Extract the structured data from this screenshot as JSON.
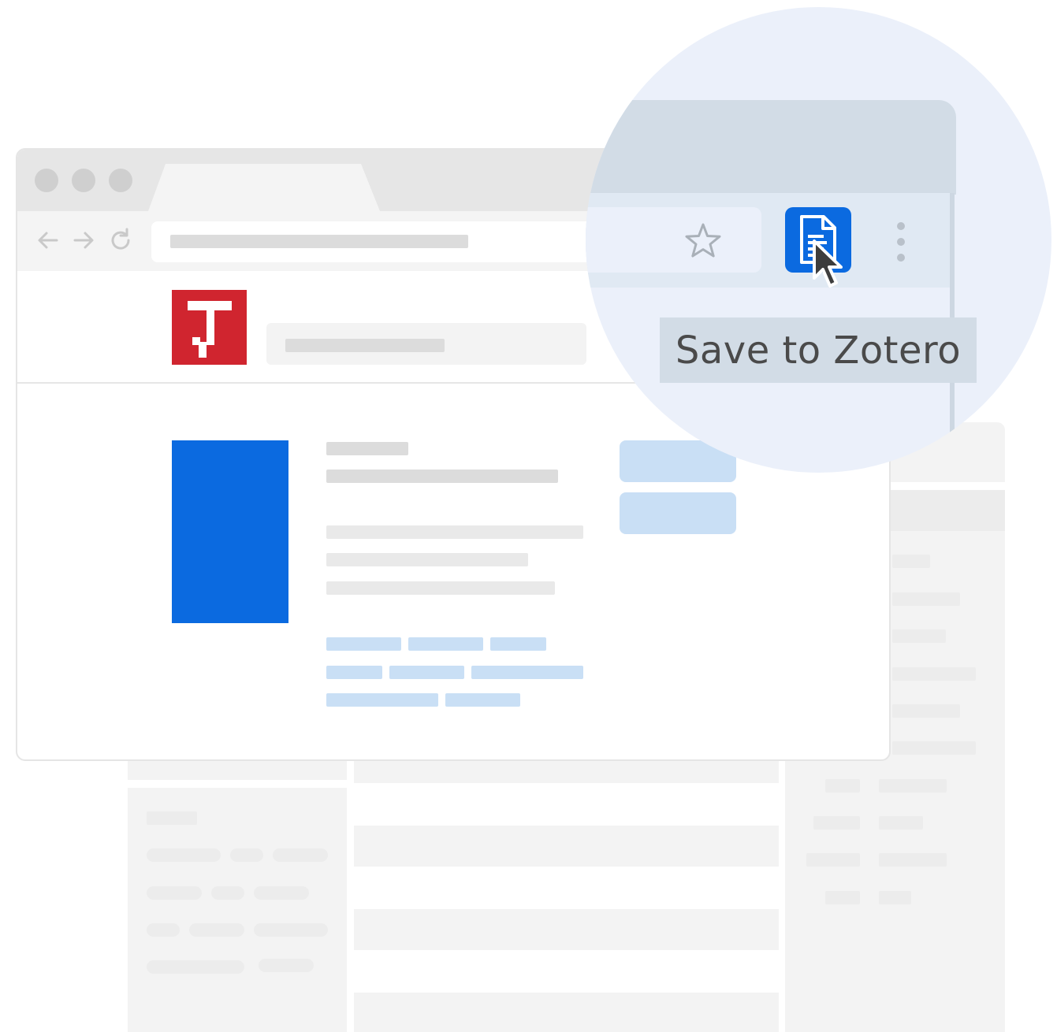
{
  "browser": {
    "window_buttons": [
      "close",
      "minimize",
      "maximize"
    ],
    "nav_icons": [
      "back-arrow-icon",
      "forward-arrow-icon",
      "reload-icon"
    ],
    "site_logo_letter": "J"
  },
  "extension": {
    "icon": "zotero-document-icon",
    "tooltip": "Save to Zotero",
    "bookmark_icon": "star-icon",
    "menu_icon": "kebab-menu-icon"
  },
  "colors": {
    "logo_red": "#d0252f",
    "accent_blue": "#0b6ae0",
    "magnifier_bg": "#ebf0fa"
  }
}
